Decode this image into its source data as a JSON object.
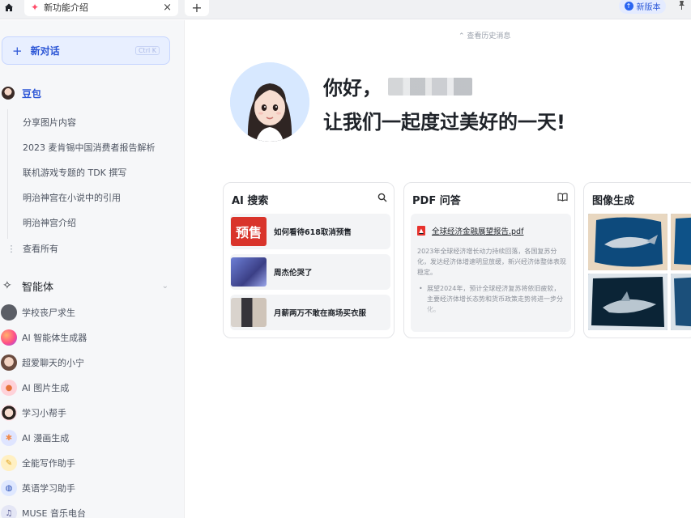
{
  "tabbar": {
    "active_tab_label": "新功能介绍",
    "close_glyph": "×",
    "new_tab_glyph": "+",
    "new_version_label": "新版本"
  },
  "sidebar": {
    "new_chat_label": "新对话",
    "new_chat_shortcut": "Ctrl K",
    "bot_name": "豆包",
    "history": [
      "分享图片内容",
      "2023 麦肯锡中国消费者报告解析",
      "联机游戏专题的 TDK 撰写",
      "明治神宫在小说中的引用",
      "明治神宫介绍"
    ],
    "see_all_label": "查看所有",
    "agents_heading": "智能体",
    "agents": [
      {
        "label": "学校丧尸求生",
        "icon": "zombie-avatar",
        "color": "#5b5e66"
      },
      {
        "label": "AI 智能体生成器",
        "icon": "gradient-orb",
        "color": "#ff5a7a"
      },
      {
        "label": "超爱聊天的小宁",
        "icon": "girl-avatar",
        "color": "#c79b86"
      },
      {
        "label": "AI 图片生成",
        "icon": "palette",
        "color": "#ffd2d9"
      },
      {
        "label": "学习小帮手",
        "icon": "student-avatar",
        "color": "#ffe3e8"
      },
      {
        "label": "AI 漫画生成",
        "icon": "comic",
        "color": "#dfe5ff"
      },
      {
        "label": "全能写作助手",
        "icon": "pen",
        "color": "#fff0c2"
      },
      {
        "label": "英语学习助手",
        "icon": "globe",
        "color": "#dfe8ff"
      },
      {
        "label": "MUSE 音乐电台",
        "icon": "music",
        "color": "#e4e6f5"
      }
    ]
  },
  "main": {
    "history_link": "查看历史消息",
    "greeting": "你好，",
    "subtitle": "让我们一起度过美好的一天!",
    "cards": {
      "search": {
        "title": "AI 搜索",
        "items": [
          "如何看待618取消预售",
          "周杰伦哭了",
          "月薪两万不敢在商场买衣服"
        ],
        "thumb1_text": "预售"
      },
      "pdf": {
        "title": "PDF 问答",
        "file_name": "全球经济金融展望报告.pdf",
        "paragraph": "2023年全球经济增长动力持续回落，各国复苏分化，发达经济体增速明显放缓，新兴经济体整体表现稳定。",
        "bullet": "展望2024年，预计全球经济复苏将依旧疲软，主要经济体增长态势和货币政策走势将进一步分化。"
      },
      "image": {
        "title": "图像生成"
      }
    }
  },
  "colors": {
    "accent": "#2b55d6",
    "sidebar_bg": "#f6f7f9",
    "card_bg": "#f3f4f6"
  }
}
